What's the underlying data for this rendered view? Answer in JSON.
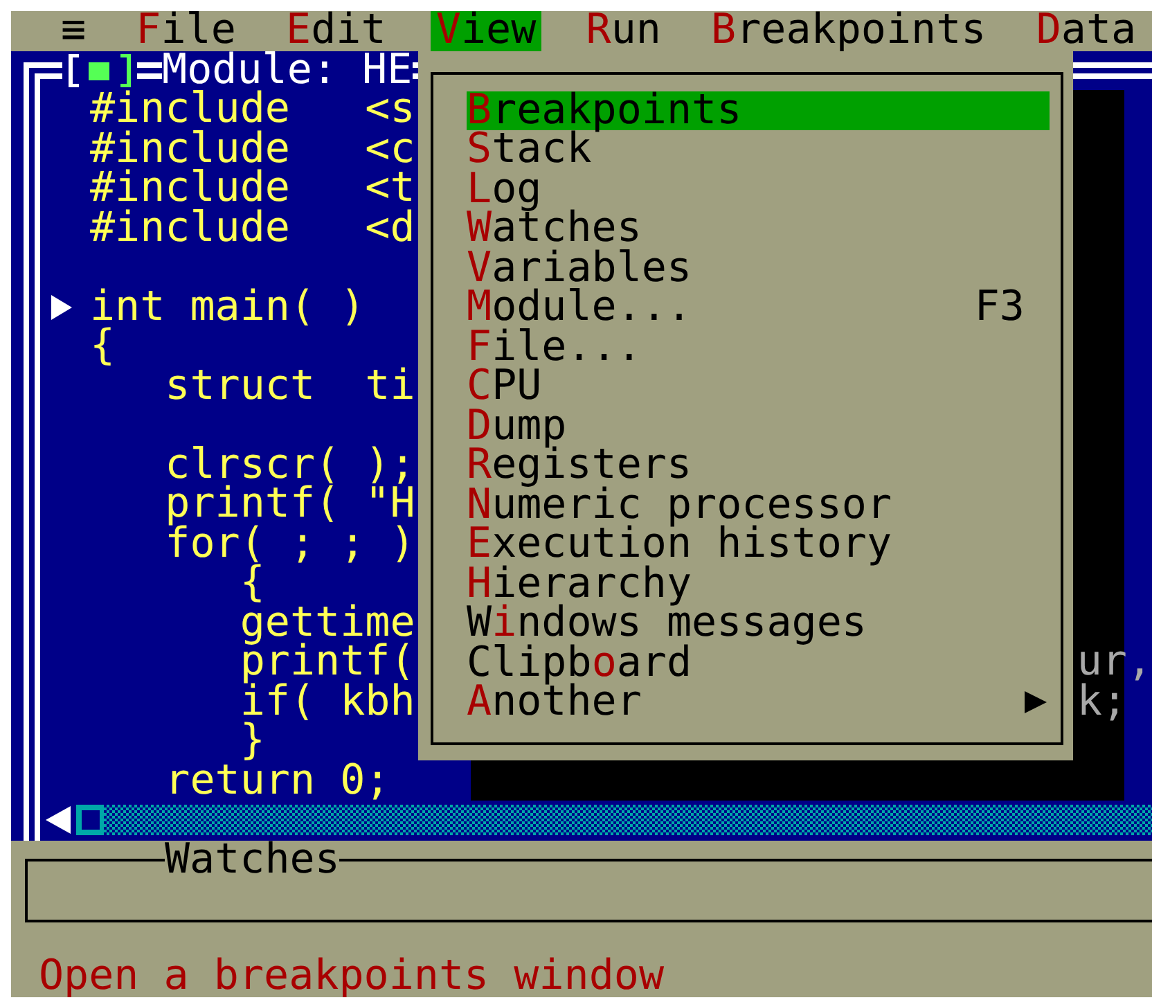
{
  "menu_bar": [
    {
      "after": "≡",
      "selected": false
    },
    {
      "hotkey": "F",
      "after": "ile",
      "selected": false
    },
    {
      "hotkey": "E",
      "after": "dit",
      "selected": false
    },
    {
      "hotkey": "V",
      "after": "iew",
      "selected": true
    },
    {
      "hotkey": "R",
      "after": "un",
      "selected": false
    },
    {
      "hotkey": "B",
      "after": "reakpoints",
      "selected": false
    },
    {
      "hotkey": "D",
      "after": "ata",
      "selected": false
    }
  ],
  "module_window": {
    "title": "Module: HE",
    "lines": [
      {
        "text": "#include   <s",
        "current": false
      },
      {
        "text": "#include   <c",
        "current": false
      },
      {
        "text": "#include   <t",
        "current": false
      },
      {
        "text": "#include   <d",
        "current": false
      },
      {
        "current": false
      },
      {
        "text": "int main( )",
        "current": true
      },
      {
        "text": "{",
        "current": false
      },
      {
        "text": "   struct  ti",
        "current": false
      },
      {
        "current": false
      },
      {
        "text": "   clrscr( );",
        "current": false
      },
      {
        "text": "   printf( \"H",
        "current": false
      },
      {
        "text": "   for( ; ; )",
        "current": false
      },
      {
        "text": "      {",
        "current": false
      },
      {
        "text": "      gettime",
        "current": false
      },
      {
        "text": "      printf(",
        "tail": "ur,",
        "current": false
      },
      {
        "text": "      if( kbh",
        "tail": "k;",
        "current": false
      },
      {
        "text": "      }",
        "current": false
      },
      {
        "text": "   return 0;",
        "current": false
      }
    ]
  },
  "view_menu": {
    "items": [
      {
        "hotkey": "B",
        "after": "reakpoints",
        "selected": true,
        "submenu": false
      },
      {
        "hotkey": "S",
        "after": "tack",
        "selected": false,
        "submenu": false
      },
      {
        "hotkey": "L",
        "after": "og",
        "selected": false,
        "submenu": false
      },
      {
        "hotkey": "W",
        "after": "atches",
        "selected": false,
        "submenu": false
      },
      {
        "hotkey": "V",
        "after": "ariables",
        "selected": false,
        "submenu": false
      },
      {
        "hotkey": "M",
        "after": "odule...",
        "shortcut": "F3",
        "selected": false,
        "submenu": false
      },
      {
        "hotkey": "F",
        "after": "ile...",
        "selected": false,
        "submenu": false
      },
      {
        "hotkey": "C",
        "after": "PU",
        "selected": false,
        "submenu": false
      },
      {
        "hotkey": "D",
        "after": "ump",
        "selected": false,
        "submenu": false
      },
      {
        "hotkey": "R",
        "after": "egisters",
        "selected": false,
        "submenu": false
      },
      {
        "hotkey": "N",
        "after": "umeric processor",
        "selected": false,
        "submenu": false
      },
      {
        "hotkey": "E",
        "after": "xecution history",
        "selected": false,
        "submenu": false
      },
      {
        "hotkey": "H",
        "after": "ierarchy",
        "selected": false,
        "submenu": false
      },
      {
        "before": "W",
        "hotkey": "i",
        "after": "ndows messages",
        "selected": false,
        "submenu": false
      },
      {
        "before": "Clipb",
        "hotkey": "o",
        "after": "ard",
        "selected": false,
        "submenu": false
      },
      {
        "hotkey": "A",
        "after": "nother",
        "selected": false,
        "submenu": true
      }
    ]
  },
  "watches_window": {
    "title": "Watches"
  },
  "status_bar": "Open a breakpoints window"
}
